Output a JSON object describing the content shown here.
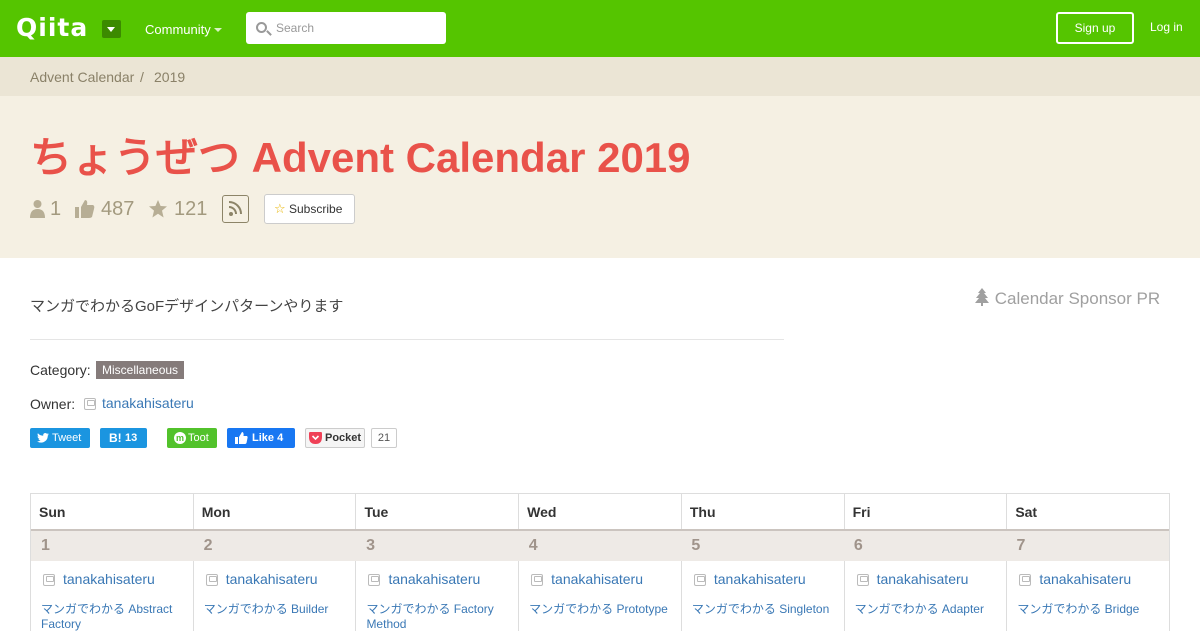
{
  "header": {
    "logo": "Qiita",
    "community_label": "Community",
    "search_placeholder": "Search",
    "signup_label": "Sign up",
    "login_label": "Log in",
    "brand_color": "#55c500"
  },
  "breadcrumb": {
    "items": [
      "Advent Calendar",
      "2019"
    ],
    "separator": "/"
  },
  "hero": {
    "title": "ちょうぜつ Advent Calendar 2019",
    "participants": "1",
    "likes": "487",
    "stocks": "121",
    "subscribe_label": "Subscribe",
    "title_color": "#e9524a"
  },
  "body": {
    "description": "マンガでわかるGoFデザインパターンやります",
    "sponsor_label": "Calendar Sponsor PR",
    "category_label": "Category:",
    "category_value": "Miscellaneous",
    "owner_label": "Owner:",
    "owner_name": "tanakahisateru"
  },
  "share": {
    "tweet": "Tweet",
    "hatena_count": "13",
    "toot": "Toot",
    "like": "Like 4",
    "pocket": "Pocket",
    "pocket_count": "21"
  },
  "calendar": {
    "days": [
      "Sun",
      "Mon",
      "Tue",
      "Wed",
      "Thu",
      "Fri",
      "Sat"
    ],
    "dates": [
      "1",
      "2",
      "3",
      "4",
      "5",
      "6",
      "7"
    ],
    "entries": [
      {
        "user": "tanakahisateru",
        "title": "マンガでわかる Abstract Factory"
      },
      {
        "user": "tanakahisateru",
        "title": "マンガでわかる Builder"
      },
      {
        "user": "tanakahisateru",
        "title": "マンガでわかる Factory Method"
      },
      {
        "user": "tanakahisateru",
        "title": "マンガでわかる Prototype"
      },
      {
        "user": "tanakahisateru",
        "title": "マンガでわかる Singleton"
      },
      {
        "user": "tanakahisateru",
        "title": "マンガでわかる Adapter"
      },
      {
        "user": "tanakahisateru",
        "title": "マンガでわかる Bridge"
      }
    ]
  }
}
